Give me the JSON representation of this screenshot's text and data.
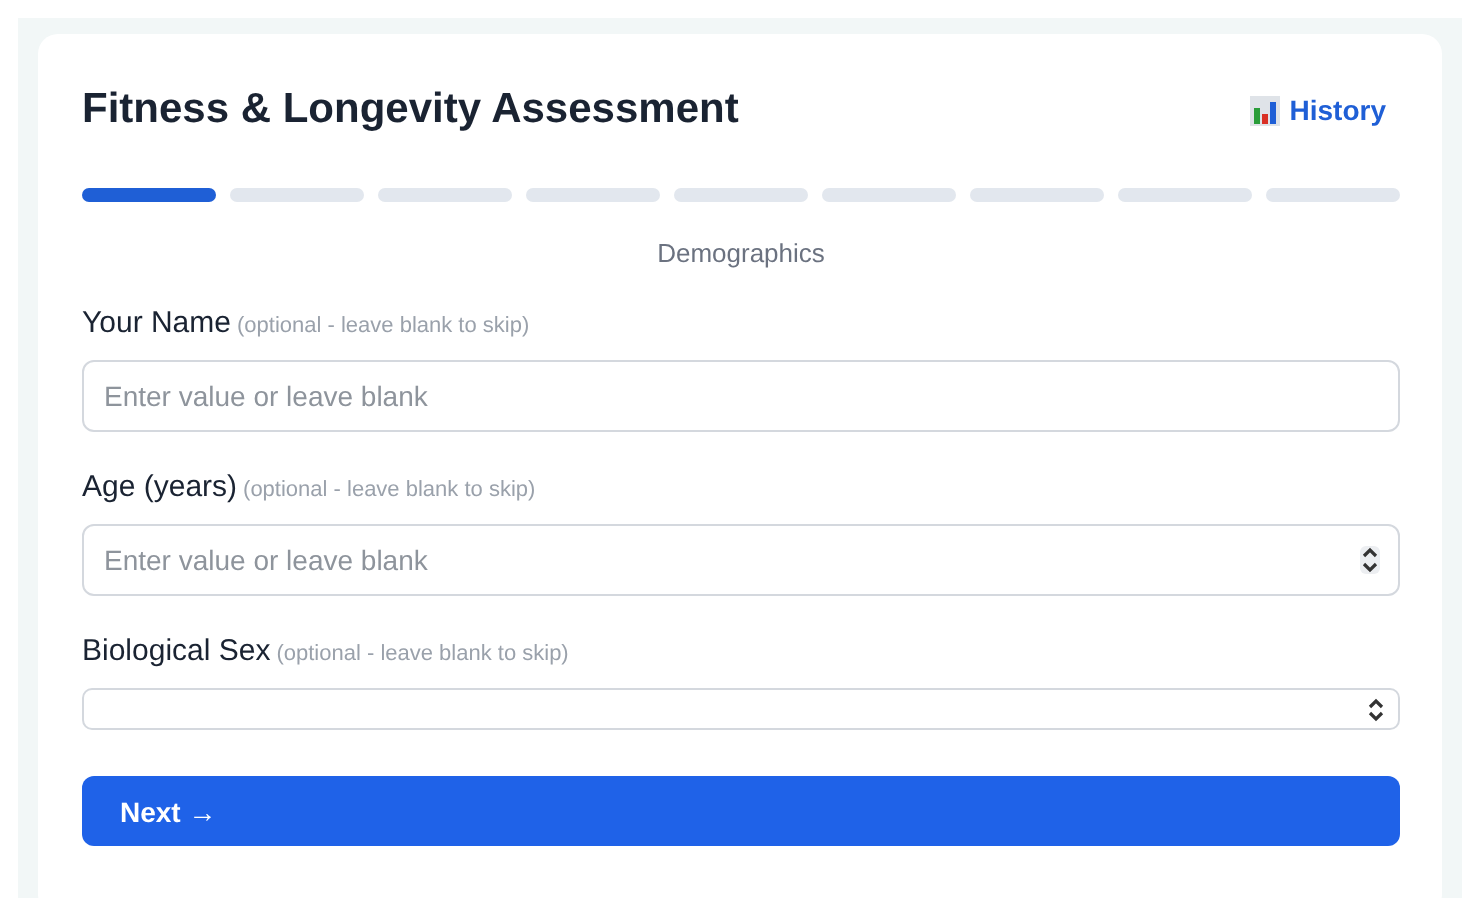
{
  "title": "Fitness & Longevity Assessment",
  "history_link": {
    "label": "History"
  },
  "steps": [
    {
      "selected": true
    },
    {
      "selected": false
    },
    {
      "selected": false
    },
    {
      "selected": false
    },
    {
      "selected": false
    },
    {
      "selected": false
    },
    {
      "selected": false
    },
    {
      "selected": false
    },
    {
      "selected": false
    }
  ],
  "step_title": "Demographics",
  "fields": [
    {
      "kind": "text",
      "label": "Your Name",
      "hint": "(optional - leave blank to skip)",
      "placeholder": "Enter value or leave blank"
    },
    {
      "kind": "number",
      "label": "Age (years)",
      "hint": "(optional - leave blank to skip)",
      "placeholder": "Enter value or leave blank"
    },
    {
      "kind": "select",
      "label": "Biological Sex",
      "hint": "(optional - leave blank to skip)"
    }
  ],
  "next_button": "Next →"
}
